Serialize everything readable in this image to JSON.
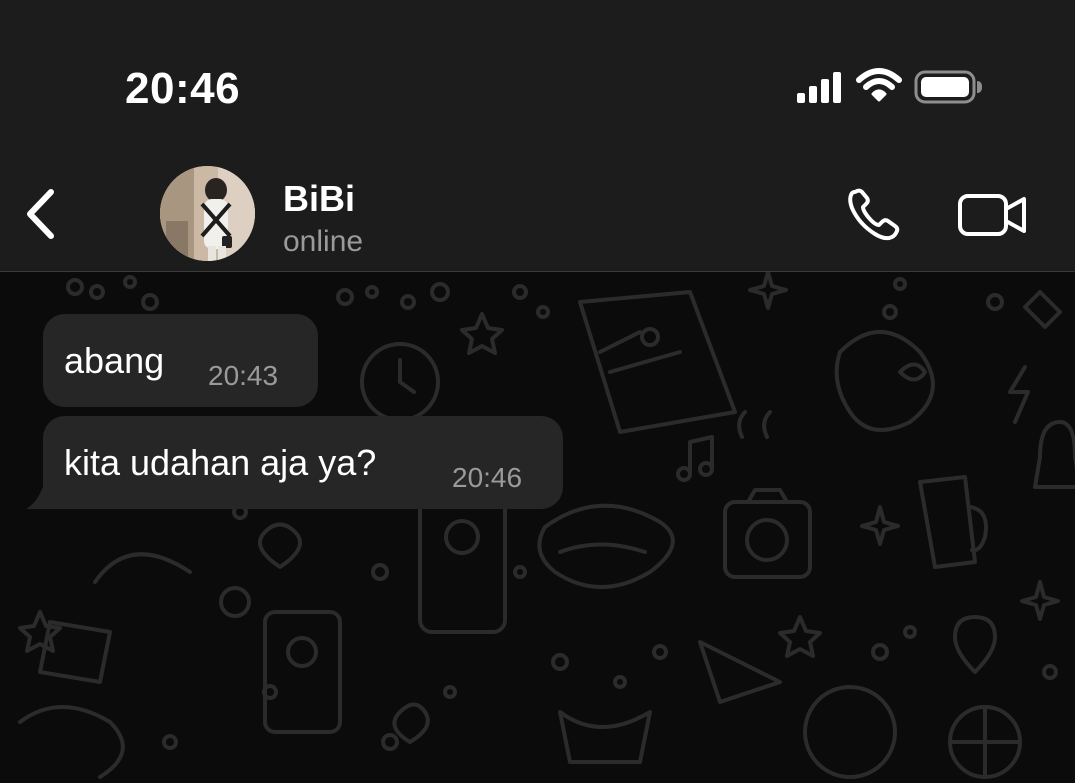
{
  "status_bar": {
    "time": "20:46",
    "icons": [
      "signal-icon",
      "wifi-icon",
      "battery-icon"
    ]
  },
  "header": {
    "contact_name": "BiBi",
    "contact_status": "online",
    "icons": [
      "back-chevron-icon",
      "phone-icon",
      "video-camera-icon"
    ]
  },
  "messages": [
    {
      "text": "abang",
      "time": "20:43"
    },
    {
      "text": "kita udahan aja ya?",
      "time": "20:46"
    }
  ],
  "colors": {
    "bar_background": "#1c1c1c",
    "chat_background": "#0b0b0b",
    "bubble": "#262626",
    "secondary_text": "#9a9a9a",
    "primary_text": "#ffffff"
  }
}
